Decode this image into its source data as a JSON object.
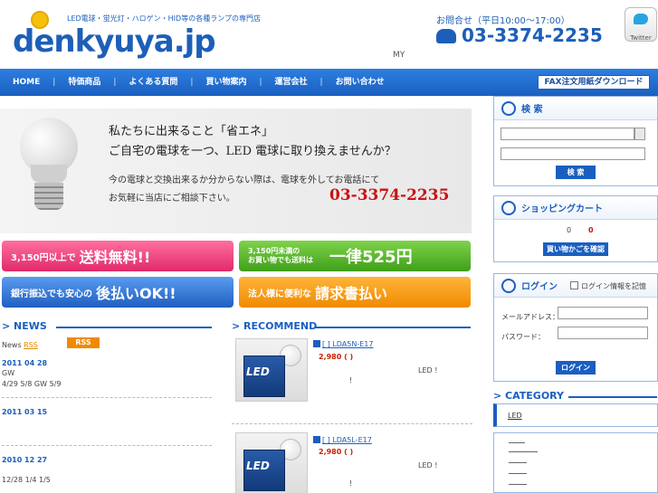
{
  "header": {
    "logo_text": "denkyuya.jp",
    "tagline": "LED電球・蛍光灯・ハロゲン・HID等の各種ランプの専門店",
    "contact_label": "お問合せ（平日10:00～17:00）",
    "contact_phone": "03-3374-2235",
    "twitter_label": "Twitter",
    "my_text": "MY"
  },
  "nav": {
    "items": [
      "HOME",
      "特価商品",
      "よくある質問",
      "買い物案内",
      "運営会社",
      "お問い合わせ"
    ],
    "separator": "|",
    "fax_button": "FAX注文用紙ダウンロード"
  },
  "hero": {
    "line1": "私たちに出来ること「省エネ」",
    "line2": "ご自宅の電球を一つ、LED 電球に取り換えませんか？",
    "line3": "今の電球と交換出来るか分からない際は、電球を外してお電話にて",
    "line4": "お気軽に当店にご相談下さい。",
    "phone": "03-3374-2235"
  },
  "banners": {
    "b1_small": "3,150円以上で",
    "b1_big": "送料無料!!",
    "b2_small_line1": "3,150円未満の",
    "b2_small_line2": "お買い物でも送料は",
    "b2_big": "一律525円",
    "b3_small": "銀行振込でも安心の",
    "b3_big": "後払いOK!!",
    "b4_small": "法人様に便利な",
    "b4_big": "請求書払い"
  },
  "news": {
    "title": "> NEWS",
    "rss_prefix": "News",
    "rss_link": "RSS",
    "rss_badge": "RSS",
    "items": [
      {
        "date": "2011 04 28",
        "line1": "GW",
        "line2": "4/29 5/8   GW              5/9"
      },
      {
        "date": "2011 03 15",
        "line1": "",
        "line2": ""
      },
      {
        "date": "2010 12 27",
        "line1": "",
        "line2": "12/28 1/4           1/5"
      }
    ]
  },
  "recommend": {
    "title": "> RECOMMEND",
    "items": [
      {
        "link": "[  ] LDA5N-E17",
        "price": "2,980  (  )",
        "desc": "LED   !",
        "excl": "!",
        "box_text": "LED"
      },
      {
        "link": "[  ] LDA5L-E17",
        "price": "2,980  (  )",
        "desc": "LED   !",
        "excl": "!",
        "box_text": "LED"
      }
    ]
  },
  "sidebar": {
    "search_title": "検  索",
    "search_button": "検  索",
    "cart_title": "ショッピングカート",
    "cart_count": "0",
    "cart_total": "0",
    "cart_button": "買い物かごを確認",
    "login_title": "ログイン",
    "login_remember": "ログイン情報を記憶",
    "login_email_label": "メールアドレス：",
    "login_password_label": "パスワード：",
    "login_button": "ログイン",
    "category_title": "> CATEGORY",
    "category_item": "LED"
  }
}
